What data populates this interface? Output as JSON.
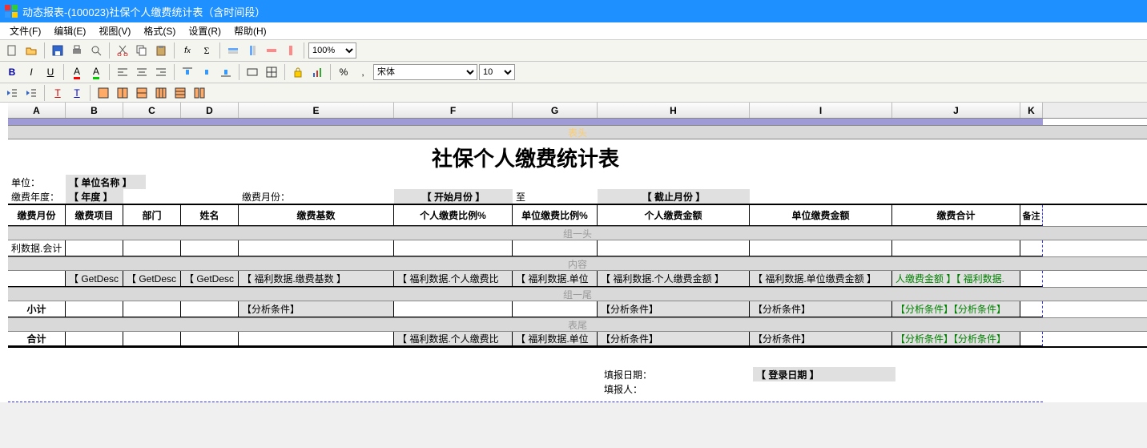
{
  "title": "动态报表-(100023)社保个人缴费统计表（含时间段）",
  "menu": {
    "file": "文件(F)",
    "edit": "编辑(E)",
    "view": "视图(V)",
    "format": "格式(S)",
    "setting": "设置(R)",
    "help": "帮助(H)"
  },
  "toolbar": {
    "zoom": "100%",
    "font": "宋体",
    "size": "10",
    "percent": "%",
    "comma": ","
  },
  "columns": [
    "A",
    "B",
    "C",
    "D",
    "E",
    "F",
    "G",
    "H",
    "I",
    "J",
    "K"
  ],
  "band": {
    "head": "表头",
    "group_head": "组一头",
    "content": "内容",
    "group_foot": "组一尾",
    "foot": "表尾"
  },
  "report": {
    "title": "社保个人缴费统计表",
    "info": {
      "unit_label": "单位：",
      "unit_val": "【 单位名称 】",
      "year_label": "缴费年度：",
      "year_val": "【 年度 】",
      "month_label": "缴费月份：",
      "start_val": "【 开始月份 】",
      "to": "至",
      "end_val": "【 截止月份 】"
    },
    "headers": {
      "A": "缴费月份",
      "B": "缴费项目",
      "C": "部门",
      "D": "姓名",
      "E": "缴费基数",
      "F": "个人缴费比例%",
      "G": "单位缴费比例%",
      "H": "个人缴费金额",
      "I": "单位缴费金额",
      "J": "缴费合计",
      "K": "备注"
    },
    "group_head_row": {
      "A": "利数据.会计"
    },
    "content_row": {
      "B": "【 GetDesc",
      "C": "【 GetDesc",
      "D": "【 GetDesc",
      "E": "【 福利数据.缴费基数 】",
      "F": "【 福利数据.个人缴费比",
      "G": "【 福利数据.单位",
      "H": "【 福利数据.个人缴费金额 】",
      "I": "【 福利数据.单位缴费金额 】",
      "J": "人缴费金额 】【 福利数据."
    },
    "subtotal": {
      "label": "小计",
      "E": "【分析条件】",
      "H": "【分析条件】",
      "I": "【分析条件】",
      "J": "【分析条件】【分析条件】"
    },
    "total": {
      "label": "合计",
      "F": "【 福利数据.个人缴费比",
      "G": "【 福利数据.单位",
      "H": "【分析条件】",
      "I": "【分析条件】",
      "J": "【分析条件】【分析条件】"
    },
    "footer": {
      "date_label": "填报日期：",
      "date_val": "【 登录日期 】",
      "person_label": "填报人："
    }
  }
}
